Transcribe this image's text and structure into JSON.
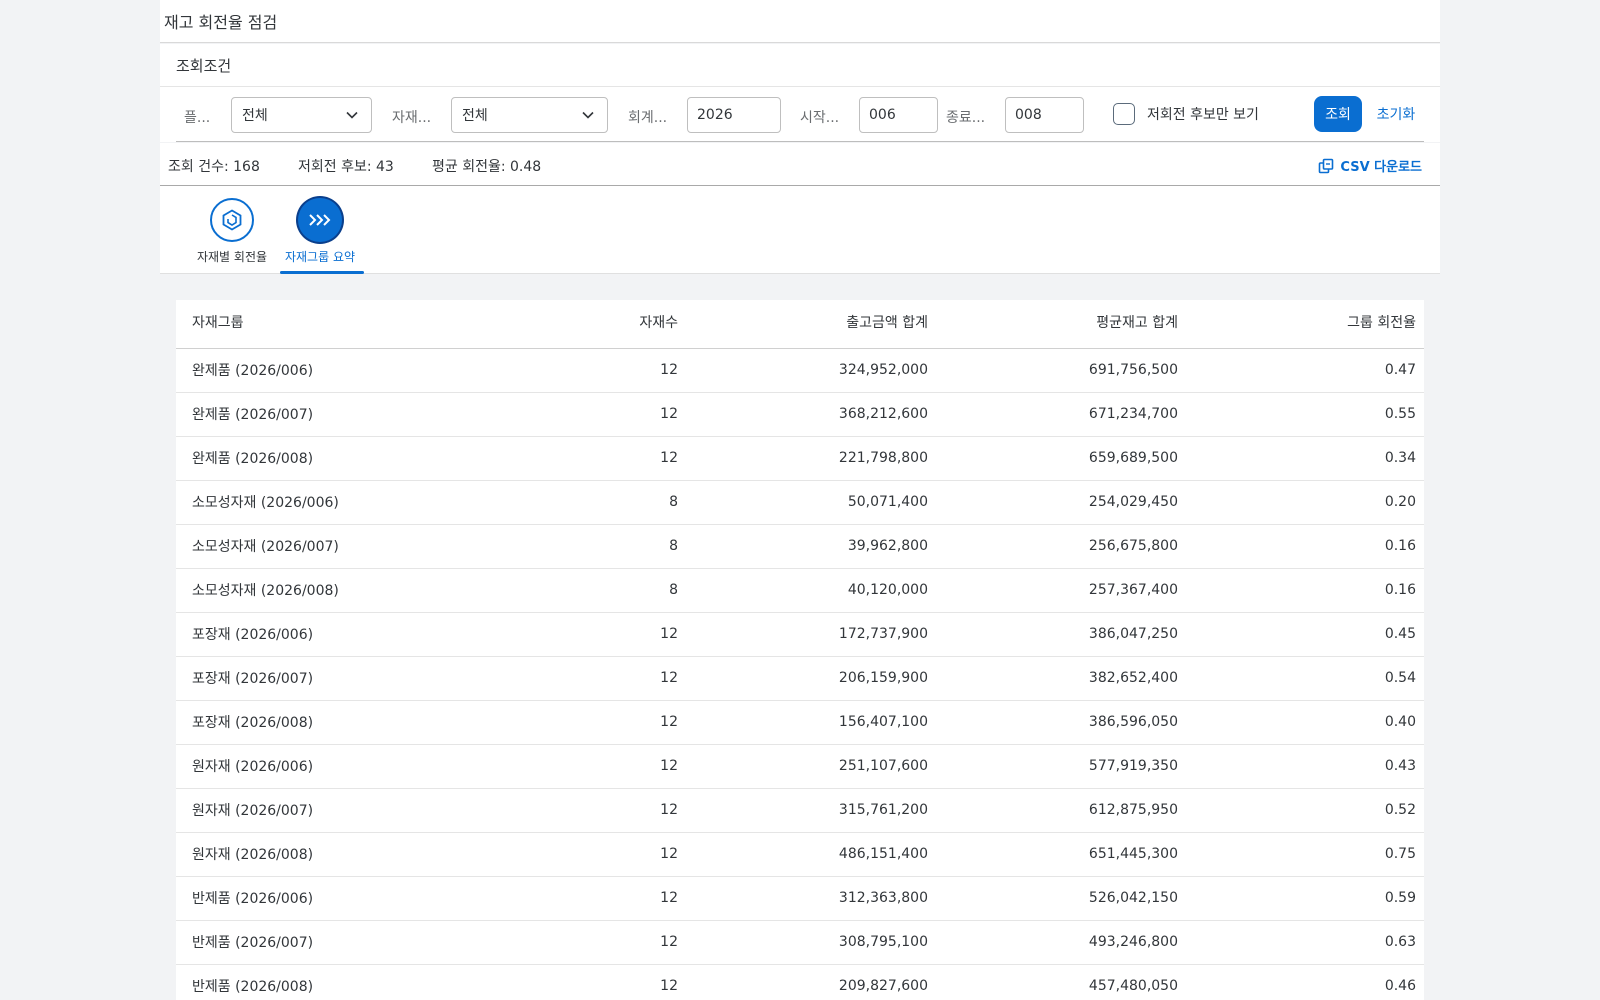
{
  "app": {
    "title": "재고 회전율 점검"
  },
  "filter": {
    "header": "조회조건",
    "plant_label": "플...",
    "plant_value": "전체",
    "material_label": "자재...",
    "material_value": "전체",
    "fiscal_label": "회계...",
    "fiscal_value": "2026",
    "start_label": "시작...",
    "start_value": "006",
    "end_label": "종료...",
    "end_value": "008",
    "low_only_label": "저회전 후보만 보기",
    "search_button": "조회",
    "reset_button": "초기화"
  },
  "summary": {
    "count": "조회 건수: 168",
    "low_candidates": "저회전 후보: 43",
    "avg_turnover": "평균 회전율: 0.48",
    "csv_download": "CSV 다운로드"
  },
  "tabs": [
    {
      "label": "자재별 회전율",
      "icon": "refresh-cube-icon",
      "selected": false
    },
    {
      "label": "자재그룹 요약",
      "icon": "chevrons-right-icon",
      "selected": true
    }
  ],
  "table": {
    "columns": [
      "자재그룹",
      "자재수",
      "출고금액 합계",
      "평균재고 합계",
      "그룹 회전율"
    ],
    "rows": [
      [
        "완제품 (2026/006)",
        "12",
        "324,952,000",
        "691,756,500",
        "0.47"
      ],
      [
        "완제품 (2026/007)",
        "12",
        "368,212,600",
        "671,234,700",
        "0.55"
      ],
      [
        "완제품 (2026/008)",
        "12",
        "221,798,800",
        "659,689,500",
        "0.34"
      ],
      [
        "소모성자재 (2026/006)",
        "8",
        "50,071,400",
        "254,029,450",
        "0.20"
      ],
      [
        "소모성자재 (2026/007)",
        "8",
        "39,962,800",
        "256,675,800",
        "0.16"
      ],
      [
        "소모성자재 (2026/008)",
        "8",
        "40,120,000",
        "257,367,400",
        "0.16"
      ],
      [
        "포장재 (2026/006)",
        "12",
        "172,737,900",
        "386,047,250",
        "0.45"
      ],
      [
        "포장재 (2026/007)",
        "12",
        "206,159,900",
        "382,652,400",
        "0.54"
      ],
      [
        "포장재 (2026/008)",
        "12",
        "156,407,100",
        "386,596,050",
        "0.40"
      ],
      [
        "원자재 (2026/006)",
        "12",
        "251,107,600",
        "577,919,350",
        "0.43"
      ],
      [
        "원자재 (2026/007)",
        "12",
        "315,761,200",
        "612,875,950",
        "0.52"
      ],
      [
        "원자재 (2026/008)",
        "12",
        "486,151,400",
        "651,445,300",
        "0.75"
      ],
      [
        "반제품 (2026/006)",
        "12",
        "312,363,800",
        "526,042,150",
        "0.59"
      ],
      [
        "반제품 (2026/007)",
        "12",
        "308,795,100",
        "493,246,800",
        "0.63"
      ],
      [
        "반제품 (2026/008)",
        "12",
        "209,827,600",
        "457,480,050",
        "0.46"
      ]
    ]
  },
  "colors": {
    "accent": "#0a6ed1",
    "text": "#32363a",
    "background": "#f2f3f5"
  }
}
